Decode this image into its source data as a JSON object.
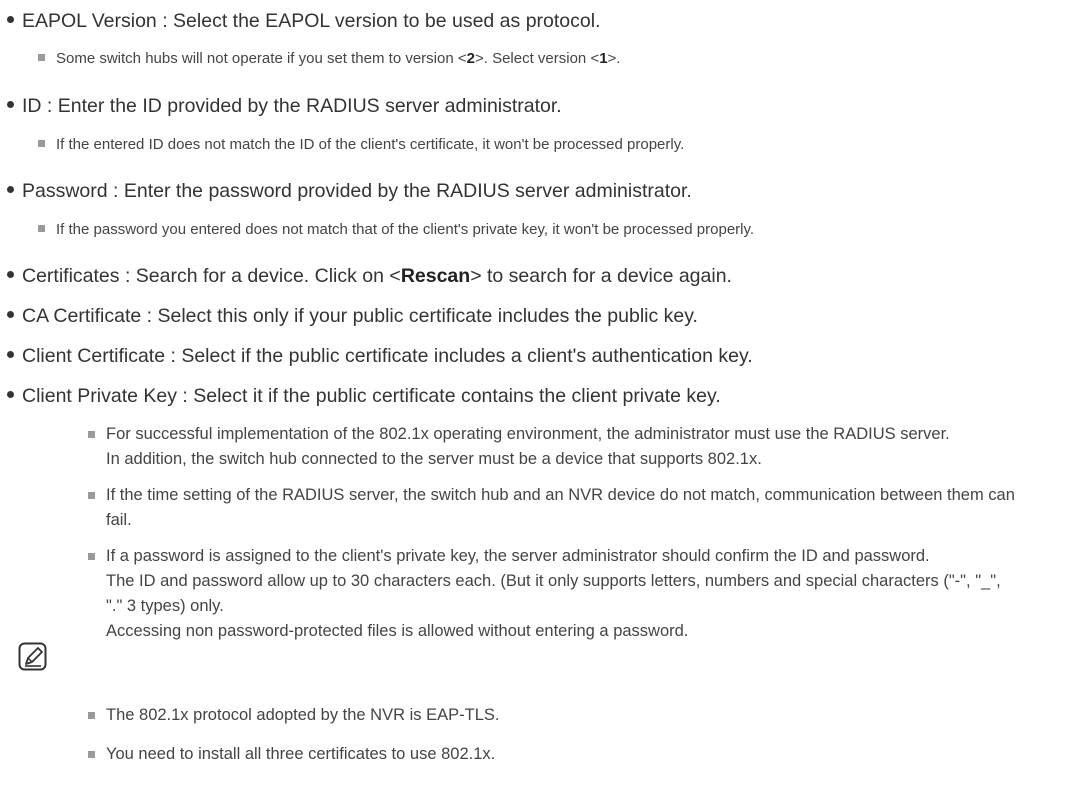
{
  "bullets": [
    {
      "label": "EAPOL Version",
      "desc": "Select the EAPOL version to be used as protocol."
    },
    {
      "label": "ID",
      "desc": "Enter the ID provided by the RADIUS server administrator."
    },
    {
      "label": "Password",
      "desc": "Enter the password provided by the RADIUS server administrator."
    },
    {
      "label": "Certificates",
      "desc_before": "Search for a device. Click on <",
      "desc_bold": "Rescan",
      "desc_after": "> to search for a device again."
    },
    {
      "label": "CA Certificate",
      "desc": "Select this only if your public certificate includes the public key."
    },
    {
      "label": "Client Certificate",
      "desc": "Select if the public certificate includes a client's authentication key."
    },
    {
      "label": "Client Private Key",
      "desc": "Select it if the public certificate contains the client private key."
    }
  ],
  "separator": " : ",
  "subnotes": {
    "eapol": {
      "before": "Some switch hubs will not operate if you set them to version <",
      "bold1": "2",
      "middle": ">. Select version <",
      "bold2": "1",
      "after": ">."
    },
    "id": "If the entered ID does not match the ID of the client's certificate, it won't be processed properly.",
    "password": "If the password you entered does not match that of the client's private key, it won't be processed properly."
  },
  "note": {
    "icon": "note-pencil-icon",
    "items": [
      {
        "lines": [
          "For successful implementation of the 802.1x operating environment, the administrator must use the RADIUS server.",
          "In addition, the switch hub connected to the server must be a device that supports 802.1x."
        ]
      },
      {
        "lines": [
          "If the time setting of the RADIUS server, the switch hub and an NVR device do not match, communication between them can",
          "fail."
        ]
      },
      {
        "lines": [
          "If a password is assigned to the client's private key, the server administrator should confirm the ID and password.",
          "The ID and password allow up to 30 characters each. (But it only supports letters, numbers and special characters (\"-\", \"_\",",
          "\".\" 3 types) only.",
          "Accessing non password-protected files is allowed without entering a password."
        ]
      },
      {
        "lines": [
          "The 802.1x protocol adopted by the NVR is EAP-TLS."
        ]
      },
      {
        "lines": [
          "You need to install all three certificates to use 802.1x."
        ]
      }
    ]
  }
}
